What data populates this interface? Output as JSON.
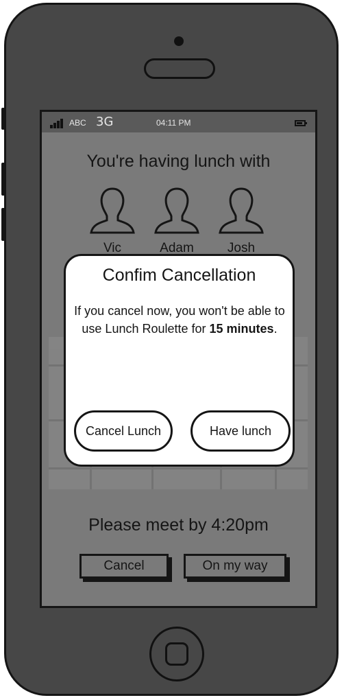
{
  "status_bar": {
    "carrier": "ABC",
    "network": "3G",
    "time": "04:11 PM",
    "battery_icon": "battery-icon",
    "signal_icon": "signal-icon"
  },
  "screen": {
    "headline": "You're having lunch with",
    "people": [
      {
        "name": "Vic",
        "icon": "person-icon"
      },
      {
        "name": "Adam",
        "icon": "person-icon"
      },
      {
        "name": "Josh",
        "icon": "person-icon"
      }
    ],
    "meet_text": "Please meet by 4:20pm",
    "cancel_label": "Cancel",
    "on_my_way_label": "On my way"
  },
  "dialog": {
    "title": "Confim Cancellation",
    "message_pre": "If you cancel now, you won't be able to use Lunch Roulette for ",
    "message_bold": "15 minutes",
    "message_post": ".",
    "cancel_lunch_label": "Cancel Lunch",
    "have_lunch_label": "Have lunch"
  },
  "colors": {
    "phone_body": "#474747",
    "screen_bg": "#7a7a7a",
    "dialog_bg": "#ffffff",
    "ink": "#151515"
  }
}
